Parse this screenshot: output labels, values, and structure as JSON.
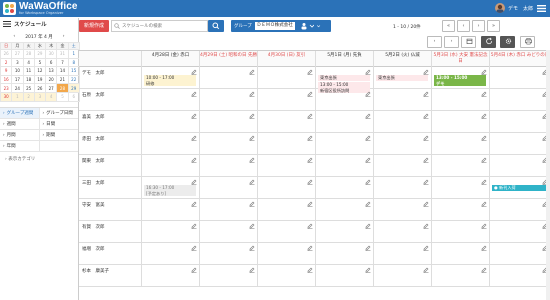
{
  "app": {
    "name": "WaWaOffice",
    "sub": "for Workspace Organizer",
    "user": "デモ　太郎"
  },
  "toolbar": {
    "new_label": "新規作成",
    "search_placeholder": "スケジュールの検索",
    "group_label": "グループ",
    "group_value": "ＤＥＭＯ株式会社",
    "pager_text": "1 - 10 / 20件"
  },
  "sidebar": {
    "title": "スケジュール",
    "month_label": "2017 年 4 月",
    "dow": [
      "日",
      "月",
      "火",
      "水",
      "木",
      "金",
      "土"
    ],
    "weeks": [
      [
        "26",
        "27",
        "28",
        "29",
        "30",
        "31",
        "1"
      ],
      [
        "2",
        "3",
        "4",
        "5",
        "6",
        "7",
        "8"
      ],
      [
        "9",
        "10",
        "11",
        "12",
        "13",
        "14",
        "15"
      ],
      [
        "16",
        "17",
        "18",
        "19",
        "20",
        "21",
        "22"
      ],
      [
        "23",
        "24",
        "25",
        "26",
        "27",
        "28",
        "29"
      ],
      [
        "30",
        "1",
        "2",
        "3",
        "4",
        "5",
        "6"
      ]
    ],
    "views": [
      [
        "グループ週間",
        "グループ日間"
      ],
      [
        "週間",
        "日間"
      ],
      [
        "月間",
        "期間"
      ],
      [
        "年間",
        ""
      ]
    ],
    "category_label": "表示カテゴリ"
  },
  "grid": {
    "dates": [
      "4月28日 (金) 赤口",
      "4月29日 (土) 昭和の日 先勝",
      "4月30日 (日) 友引",
      "5月1日 (月) 先負",
      "5月2日 (火) 仏滅",
      "5月3日 (水) 大安 憲法記念日",
      "5月4日 (木) 赤口 みどりの日"
    ],
    "rows": [
      {
        "name": "デモ　太郎",
        "events": [
          {
            "col": 0,
            "cls": "yellow",
            "text": "10:00 - 17:00",
            "text2": "研修"
          },
          {
            "col": 3,
            "cls": "pink",
            "text": "東京出張"
          },
          {
            "col": 4,
            "cls": "pink",
            "text": "東京出張"
          },
          {
            "col": 3,
            "cls": "pink",
            "text": "13:00 - 15:00",
            "text2": "新宿区役所訪問"
          },
          {
            "col": 5,
            "cls": "green",
            "text": "13:00 - 15:00",
            "text2": "デモ"
          }
        ]
      },
      {
        "name": "石原　太郎",
        "events": []
      },
      {
        "name": "喜美　太郎",
        "events": []
      },
      {
        "name": "赤田　太郎",
        "events": []
      },
      {
        "name": "関東　太郎",
        "events": []
      },
      {
        "name": "三田　太郎",
        "events": [
          {
            "col": 0,
            "cls": "gray",
            "text": "16:30 - 17:00",
            "text2": "[予定あり]"
          },
          {
            "col": 6,
            "cls": "cyan",
            "text": "● 新刊入荷"
          }
        ]
      },
      {
        "name": "守安　富美",
        "events": []
      },
      {
        "name": "有賀　次郎",
        "events": []
      },
      {
        "name": "福増　次郎",
        "events": []
      },
      {
        "name": "杉本　康美子",
        "events": []
      }
    ]
  },
  "colors": {
    "brand": "#2b72b8",
    "new_button": "#e04a4a",
    "holiday": "#e04a4a",
    "today": "#f2a74a"
  }
}
